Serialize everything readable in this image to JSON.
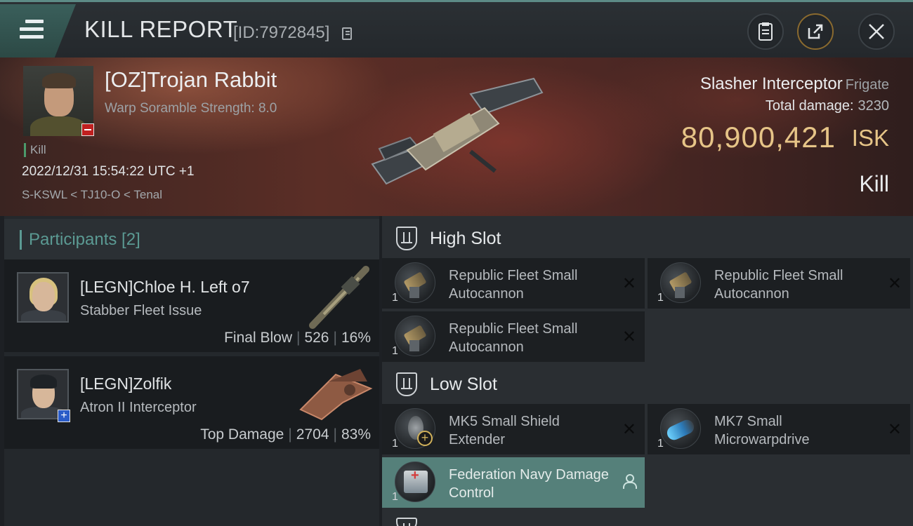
{
  "header": {
    "title": "KILL REPORT",
    "report_id": "[ID:7972845]",
    "icons": {
      "menu": "menu-icon",
      "copy": "copy-icon",
      "report": "clipboard-icon",
      "share": "share-icon",
      "close": "close-icon"
    }
  },
  "victim": {
    "name": "[OZ]Trojan Rabbit",
    "warp_scramble": "Warp Soramble Strength: 8.0",
    "tag": "Kill",
    "timestamp": "2022/12/31 15:54:22 UTC +1",
    "location": "S-KSWL < TJ10-O < Tenal",
    "ship_name": "Slasher Interceptor",
    "ship_class": "Frigate",
    "total_damage_label": "Total damage:",
    "total_damage": "3230",
    "isk_value": "80,900,421",
    "isk_unit": "ISK",
    "result": "Kill"
  },
  "participants": {
    "header": "Participants [2]",
    "rows": [
      {
        "name": "[LEGN]Chloe H. Left o7",
        "ship": "Stabber Fleet Issue",
        "role": "Final Blow",
        "damage": "526",
        "percent": "16%"
      },
      {
        "name": "[LEGN]Zolfik",
        "ship": "Atron II Interceptor",
        "role": "Top Damage",
        "damage": "2704",
        "percent": "83%"
      }
    ]
  },
  "fitting": {
    "high_slot_label": "High Slot",
    "low_slot_label": "Low Slot",
    "high_slot": [
      {
        "qty": "1",
        "name": "Republic Fleet Small Autocannon",
        "status": "destroyed"
      },
      {
        "qty": "1",
        "name": "Republic Fleet Small Autocannon",
        "status": "destroyed"
      },
      {
        "qty": "1",
        "name": "Republic Fleet Small Autocannon",
        "status": "destroyed"
      }
    ],
    "low_slot": [
      {
        "qty": "1",
        "name": "MK5 Small Shield Extender",
        "status": "destroyed"
      },
      {
        "qty": "1",
        "name": "MK7 Small Microwarpdrive",
        "status": "destroyed"
      },
      {
        "qty": "1",
        "name": "Federation Navy Damage Control",
        "status": "dropped"
      }
    ]
  },
  "colors": {
    "accent": "#5b9a93",
    "isk": "#e6c487",
    "highlight_row": "#55807a",
    "minus_badge": "#c0201f",
    "plus_badge": "#2a5cc8"
  }
}
